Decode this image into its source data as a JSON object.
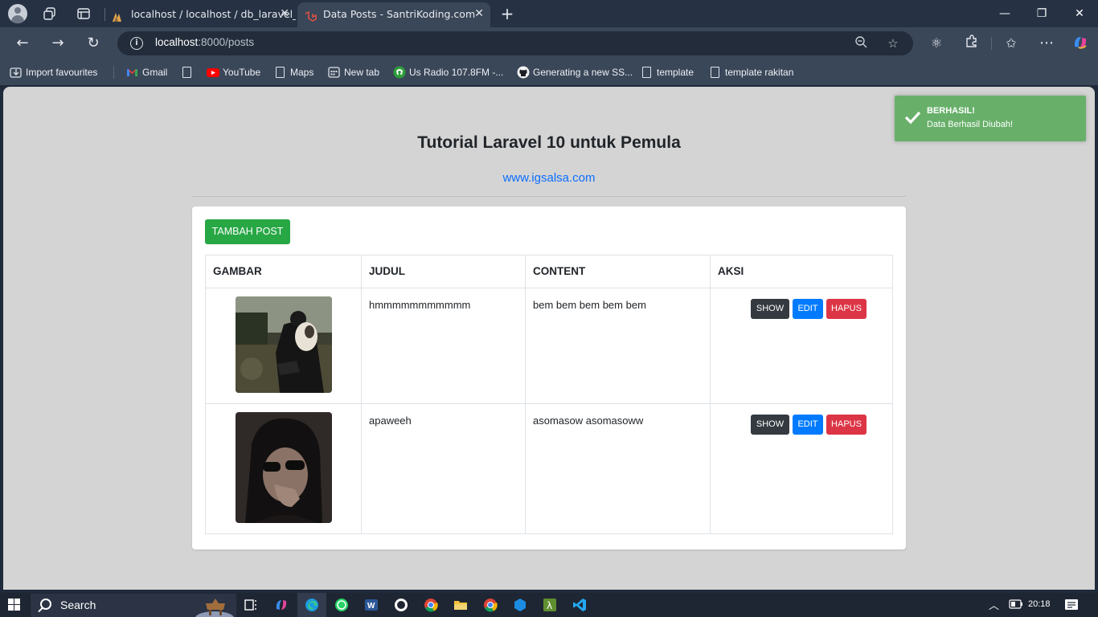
{
  "browser": {
    "tabs": [
      {
        "title": "localhost / localhost / db_laravel_"
      },
      {
        "title": "Data Posts - SantriKoding.com"
      }
    ],
    "url_host": "localhost",
    "url_rest": ":8000/posts"
  },
  "bookmarks": [
    {
      "label": "Import favourites",
      "icon": "import-icon"
    },
    {
      "label": "Gmail",
      "icon": "gmail-icon"
    },
    {
      "label": "",
      "icon": "page-icon"
    },
    {
      "label": "YouTube",
      "icon": "youtube-icon"
    },
    {
      "label": "Maps",
      "icon": "page-icon"
    },
    {
      "label": "New tab",
      "icon": "newtab-icon"
    },
    {
      "label": "Us Radio 107.8FM -...",
      "icon": "radio-icon"
    },
    {
      "label": "Generating a new SS...",
      "icon": "github-icon"
    },
    {
      "label": "template",
      "icon": "page-icon"
    },
    {
      "label": "template rakitan",
      "icon": "page-icon"
    }
  ],
  "page": {
    "title": "Tutorial Laravel 10 untuk Pemula",
    "link": "www.igsalsa.com",
    "add_button": "TAMBAH POST",
    "columns": [
      "GAMBAR",
      "JUDUL",
      "CONTENT",
      "AKSI"
    ],
    "rows": [
      {
        "judul": "hmmmmmmmmmmm",
        "content": "bem bem bem bem bem"
      },
      {
        "judul": "apaweeh",
        "content": "asomasow asomasoww"
      }
    ],
    "actions": {
      "show": "SHOW",
      "edit": "EDIT",
      "hapus": "HAPUS"
    }
  },
  "toast": {
    "title": "BERHASIL!",
    "message": "Data Berhasil Diubah!"
  },
  "taskbar": {
    "search": "Search",
    "time": "20:18"
  },
  "colors": {
    "success": "#28a745",
    "primary": "#007bff",
    "danger": "#dc3545",
    "dark": "#343a40",
    "toast": "#68b06a"
  }
}
